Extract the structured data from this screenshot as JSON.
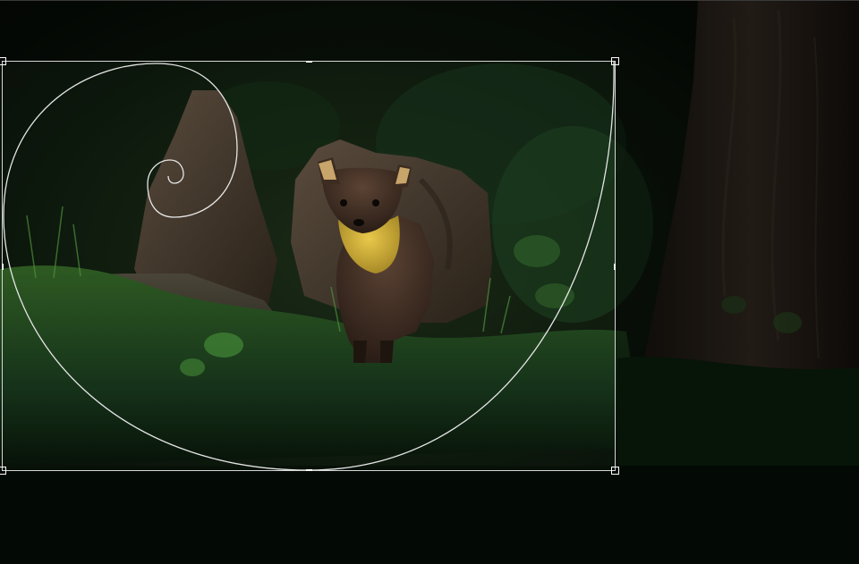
{
  "app": {
    "mode": "crop",
    "overlay": "golden-spiral"
  },
  "colors": {
    "overlay_line": "#e6e6e6",
    "crop_border": "#d6d6d6",
    "background": "#0a0d0a"
  },
  "icons": {
    "overlay": "golden-spiral-guide",
    "handles": "crop-handle"
  }
}
